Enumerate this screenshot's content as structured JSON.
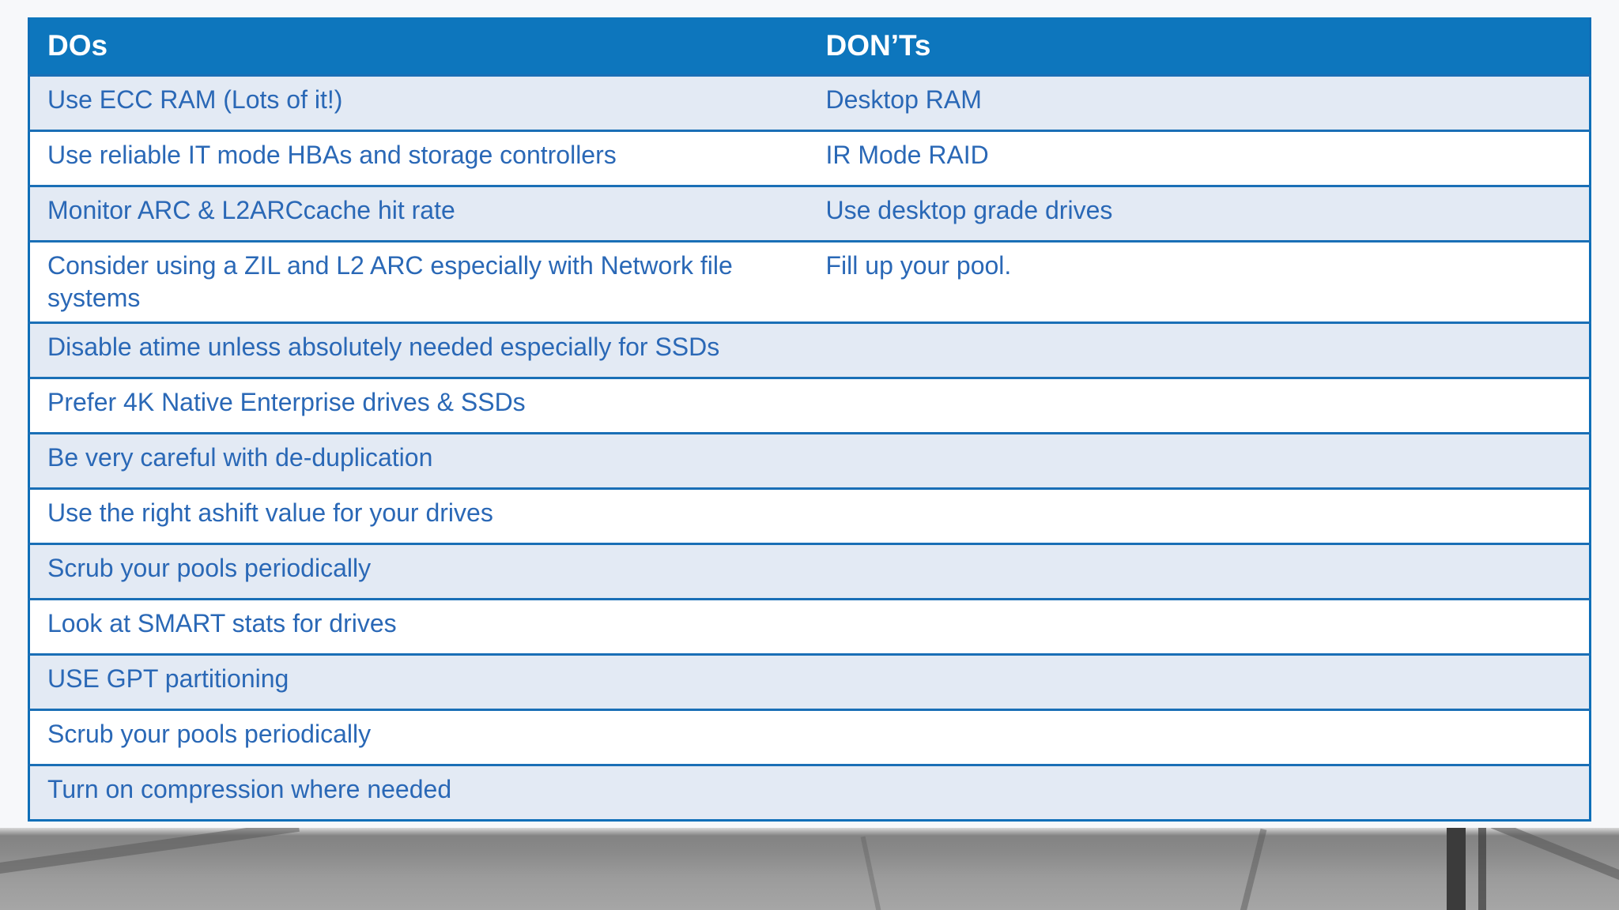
{
  "table": {
    "headers": {
      "dos": "DOs",
      "donts": "DON’Ts"
    },
    "rows": [
      {
        "do": "Use ECC RAM (Lots of it!)",
        "dont": "Desktop RAM"
      },
      {
        "do": "Use reliable IT mode HBAs and storage controllers",
        "dont": "IR Mode RAID"
      },
      {
        "do": "Monitor ARC & L2ARCcache hit rate",
        "dont": "Use desktop grade drives"
      },
      {
        "do": "Consider using a ZIL and L2 ARC especially with Network file systems",
        "dont": "Fill up your pool."
      },
      {
        "do": "Disable atime unless absolutely needed especially for SSDs",
        "dont": ""
      },
      {
        "do": "Prefer 4K Native Enterprise  drives & SSDs",
        "dont": ""
      },
      {
        "do": "Be very careful with de-duplication",
        "dont": ""
      },
      {
        "do": "Use the right ashift value for your drives",
        "dont": ""
      },
      {
        "do": "Scrub your pools periodically",
        "dont": ""
      },
      {
        "do": "Look at SMART stats for drives",
        "dont": ""
      },
      {
        "do": "USE GPT partitioning",
        "dont": ""
      },
      {
        "do": "Scrub your pools periodically",
        "dont": ""
      },
      {
        "do": "Turn on compression where needed",
        "dont": ""
      }
    ]
  },
  "colors": {
    "header_bg": "#0d76bd",
    "header_text": "#ffffff",
    "cell_text": "#2a68b6",
    "row_alt_bg": "#e3eaf4",
    "border": "#1a6fb6"
  }
}
